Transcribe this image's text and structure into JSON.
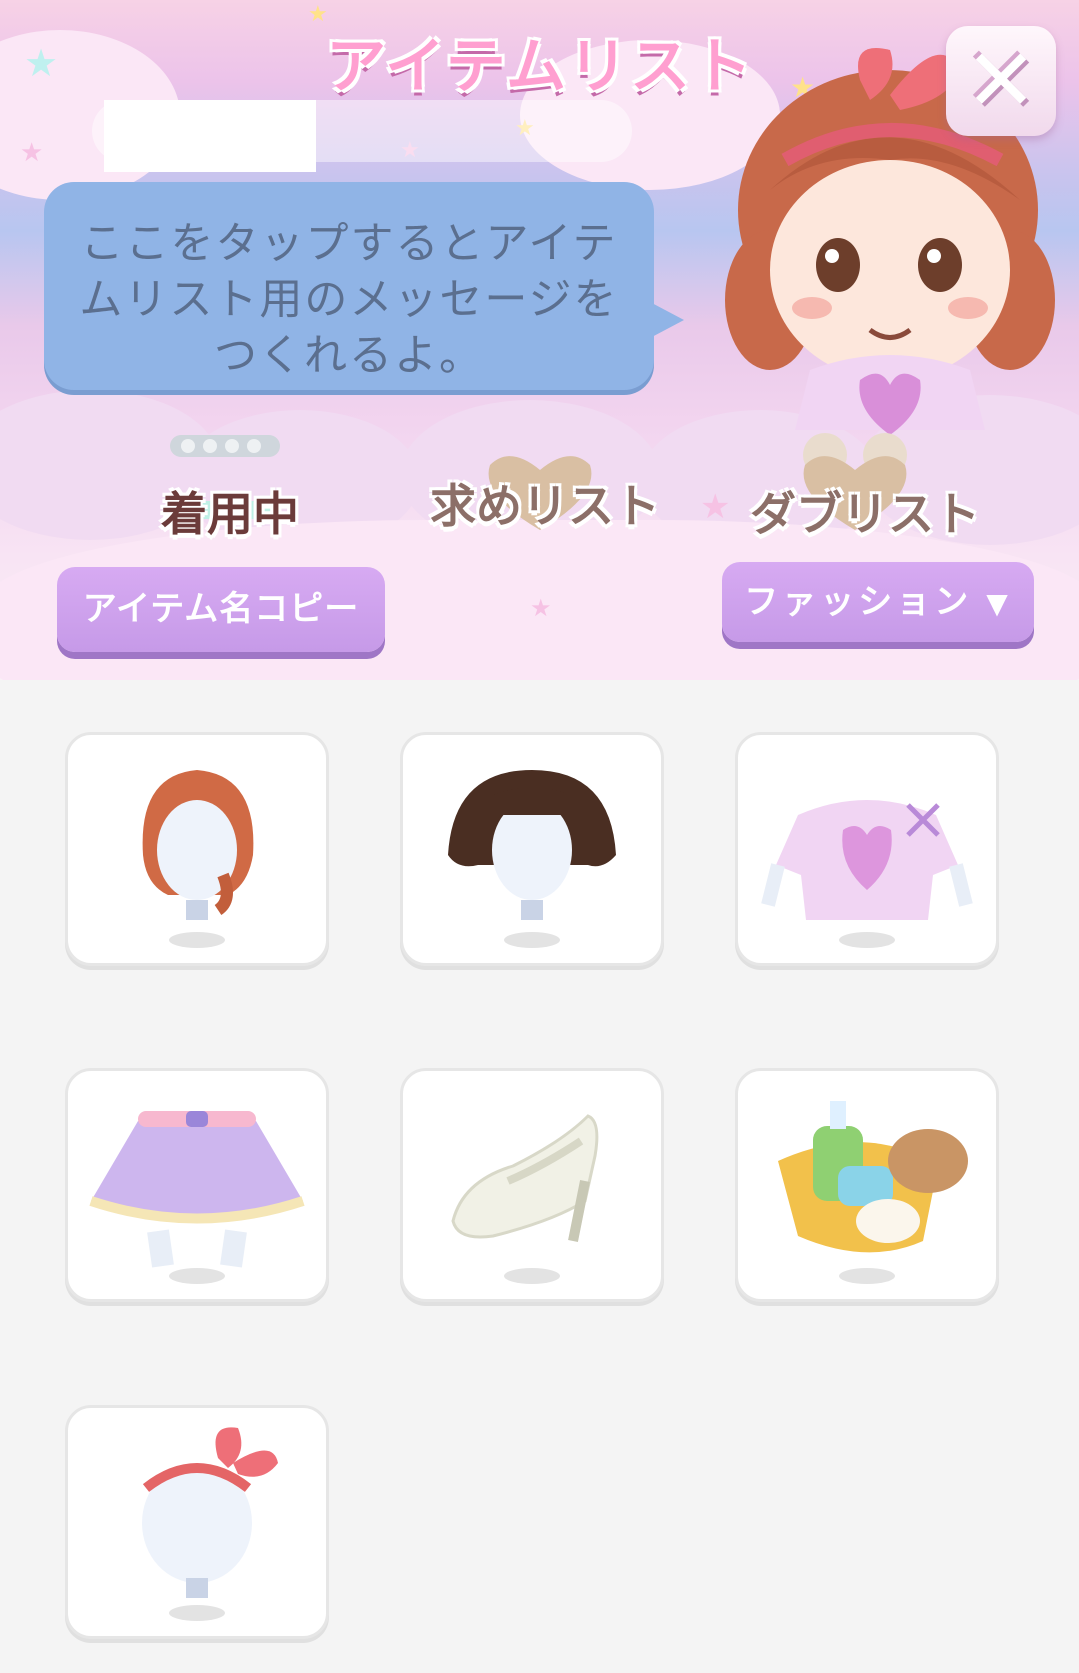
{
  "header": {
    "title": "アイテムリスト",
    "close_label": "✕",
    "bubble_message": "ここをタップするとアイテムリスト用のメッセージをつくれるよ。"
  },
  "tabs": [
    {
      "label": "着用中",
      "active": true
    },
    {
      "label": "求めリスト",
      "active": false
    },
    {
      "label": "ダブリスト",
      "active": false
    }
  ],
  "buttons": {
    "copy_names": "アイテム名コピー",
    "category_filter": "ファッション",
    "category_arrow": "▼"
  },
  "items": [
    {
      "name": "orange-braid-hair"
    },
    {
      "name": "dark-brown-bob-hair"
    },
    {
      "name": "pink-heart-top"
    },
    {
      "name": "lavender-tutu-skirt"
    },
    {
      "name": "white-heel-shoes"
    },
    {
      "name": "bath-set-item"
    },
    {
      "name": "red-ribbon-headband"
    }
  ],
  "colors": {
    "accent_purple": "#c69ae8",
    "title_pink": "#ff9fd0",
    "bubble_blue": "#90b4e6",
    "tile_background": "#ffffff",
    "page_background": "#f4f4f4"
  }
}
